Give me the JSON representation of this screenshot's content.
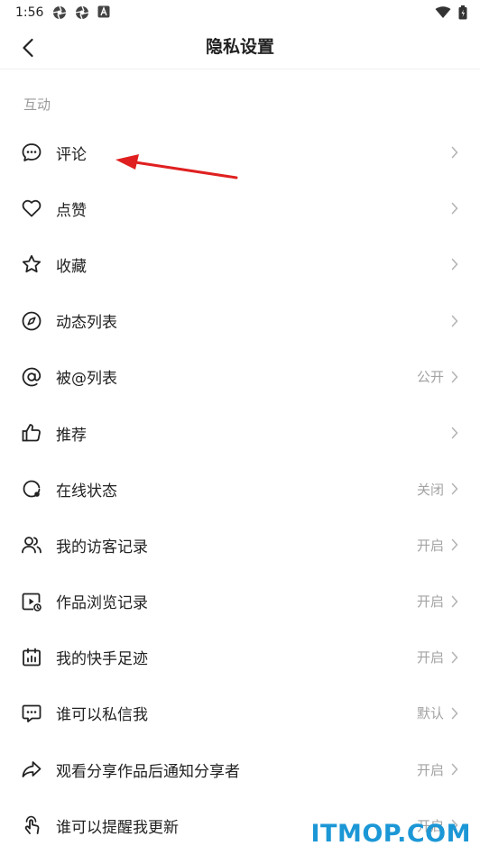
{
  "status_bar": {
    "time": "1:56",
    "icons": [
      "aperture-icon",
      "aperture-icon",
      "font-a-icon",
      "wifi-icon",
      "battery-icon"
    ]
  },
  "header": {
    "title": "隐私设置",
    "back_icon": "chevron-left-icon"
  },
  "section": {
    "title": "互动"
  },
  "items": [
    {
      "label": "评论",
      "value": "",
      "icon": "comment-icon"
    },
    {
      "label": "点赞",
      "value": "",
      "icon": "heart-icon"
    },
    {
      "label": "收藏",
      "value": "",
      "icon": "star-icon"
    },
    {
      "label": "动态列表",
      "value": "",
      "icon": "compass-icon"
    },
    {
      "label": "被@列表",
      "value": "公开",
      "icon": "at-icon"
    },
    {
      "label": "推荐",
      "value": "",
      "icon": "thumbs-up-icon"
    },
    {
      "label": "在线状态",
      "value": "关闭",
      "icon": "online-status-icon"
    },
    {
      "label": "我的访客记录",
      "value": "开启",
      "icon": "visitors-icon"
    },
    {
      "label": "作品浏览记录",
      "value": "开启",
      "icon": "video-history-icon"
    },
    {
      "label": "我的快手足迹",
      "value": "开启",
      "icon": "calendar-icon"
    },
    {
      "label": "谁可以私信我",
      "value": "默认",
      "icon": "message-icon"
    },
    {
      "label": "观看分享作品后通知分享者",
      "value": "开启",
      "icon": "share-icon"
    },
    {
      "label": "谁可以提醒我更新",
      "value": "开启",
      "icon": "touch-icon"
    }
  ],
  "watermark": "ITMOP.COM",
  "colors": {
    "accent_arrow": "#e02020",
    "watermark": "#1c97d6",
    "value_text": "#a3a3a3",
    "section_text": "#9a9a9a"
  }
}
